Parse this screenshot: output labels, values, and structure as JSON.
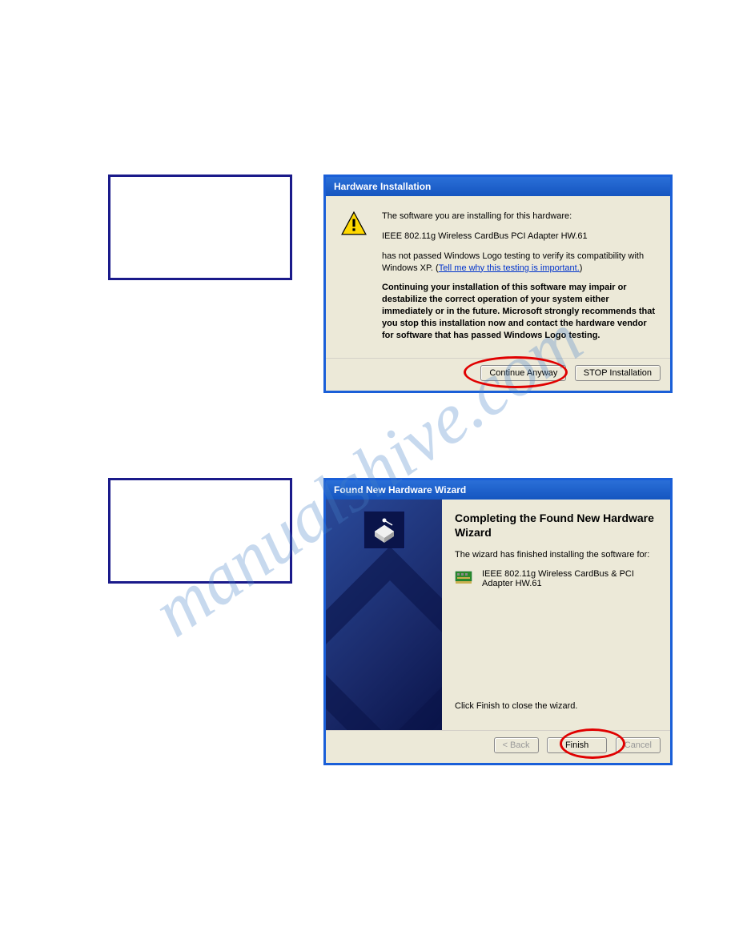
{
  "watermark": "manualshive.com",
  "dialog1": {
    "title": "Hardware Installation",
    "intro": "The software you are installing for this hardware:",
    "device": "IEEE 802.11g Wireless CardBus  PCI Adapter HW.61",
    "unsigned_prefix": "has not passed Windows Logo testing to verify its compatibility with Windows XP. (",
    "unsigned_link": "Tell me why this testing is important.",
    "unsigned_suffix": ")",
    "warning_bold": "Continuing your installation of this software may impair or destabilize the correct operation of your system either immediately or in the future. Microsoft strongly recommends that you stop this installation now and contact the hardware vendor for software that has passed Windows Logo testing.",
    "continue_btn": "Continue Anyway",
    "stop_btn": "STOP Installation"
  },
  "dialog2": {
    "title": "Found New Hardware Wizard",
    "heading": "Completing the Found New Hardware Wizard",
    "finished_text": "The wizard has finished installing the software for:",
    "device": "IEEE 802.11g Wireless CardBus & PCI Adapter HW.61",
    "close_text": "Click Finish to close the wizard.",
    "back_btn": "< Back",
    "finish_btn": "Finish",
    "cancel_btn": "Cancel"
  }
}
